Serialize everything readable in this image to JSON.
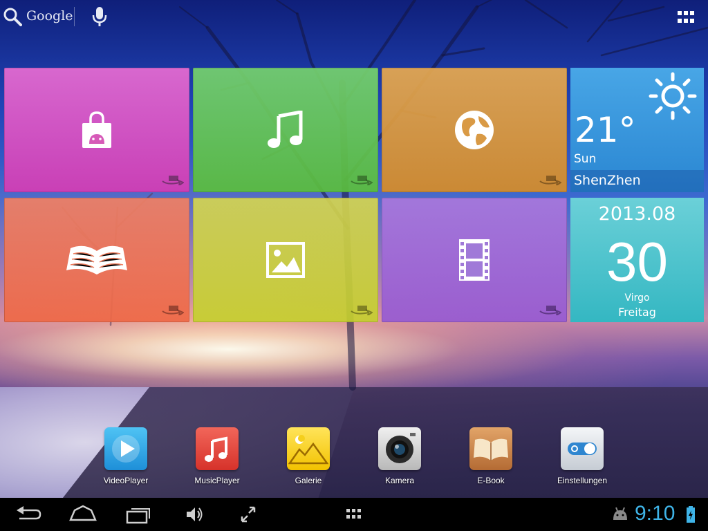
{
  "search": {
    "label": "Google"
  },
  "tiles": {
    "weather": {
      "temperature": "21°",
      "day": "Sun",
      "city": "ShenZhen"
    },
    "calendar": {
      "month": "2013.08",
      "day": "30",
      "sign": "Virgo",
      "weekday": "Freitag"
    }
  },
  "dock": [
    {
      "label": "VideoPlayer",
      "icon": "video-player-icon"
    },
    {
      "label": "MusicPlayer",
      "icon": "music-player-icon"
    },
    {
      "label": "Galerie",
      "icon": "gallery-icon"
    },
    {
      "label": "Kamera",
      "icon": "camera-icon"
    },
    {
      "label": "E-Book",
      "icon": "ebook-icon"
    },
    {
      "label": "Einstellungen",
      "icon": "settings-icon"
    }
  ],
  "status": {
    "time": "9:10",
    "accent": "#3fb4e8"
  }
}
